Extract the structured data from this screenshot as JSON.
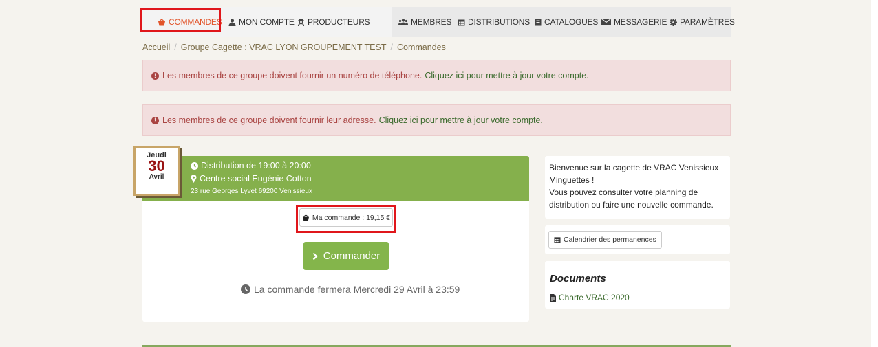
{
  "nav": {
    "left": [
      {
        "label": "COMMANDES",
        "icon": "basket-icon",
        "active": true
      },
      {
        "label": "MON COMPTE",
        "icon": "user-icon"
      },
      {
        "label": "PRODUCTEURS",
        "icon": "farmer-icon"
      }
    ],
    "right": [
      {
        "label": "MEMBRES",
        "icon": "users-icon"
      },
      {
        "label": "DISTRIBUTIONS",
        "icon": "calendar-icon"
      },
      {
        "label": "CATALOGUES",
        "icon": "book-icon"
      },
      {
        "label": "MESSAGERIE",
        "icon": "envelope-icon"
      },
      {
        "label": "PARAMÈTRES",
        "icon": "gear-icon"
      }
    ]
  },
  "breadcrumb": [
    "Accueil",
    "Groupe Cagette : VRAC LYON GROUPEMENT TEST",
    "Commandes"
  ],
  "alerts": [
    {
      "text": "Les membres de ce groupe doivent fournir un numéro de téléphone.",
      "link": "Cliquez ici pour mettre à jour votre compte."
    },
    {
      "text": "Les membres de ce groupe doivent fournir leur adresse.",
      "link": "Cliquez ici pour mettre à jour votre compte."
    }
  ],
  "distribution": {
    "day_name": "Jeudi",
    "day_number": "30",
    "month": "Avril",
    "time": "Distribution de 19:00 à 20:00",
    "place": "Centre social Eugénie Cotton",
    "address": "23 rue Georges Lyvet 69200 Venissieux",
    "my_order": "Ma commande : 19,15 €",
    "order_button": "Commander",
    "closing": "La commande fermera Mercredi 29 Avril à 23:59"
  },
  "sidebar": {
    "welcome": [
      "Bienvenue sur la cagette de VRAC Venissieux",
      "Minguettes !",
      "Vous pouvez consulter votre planning de",
      "distribution ou faire une nouvelle commande."
    ],
    "calendar_button": "Calendrier des permanences",
    "documents_title": "Documents",
    "document_link": "Charte VRAC 2020"
  },
  "colors": {
    "accent": "#e2542a",
    "green": "#85b04c",
    "alert_bg": "#f2dede",
    "alert_text": "#a94442",
    "highlight": "#e0161b"
  }
}
